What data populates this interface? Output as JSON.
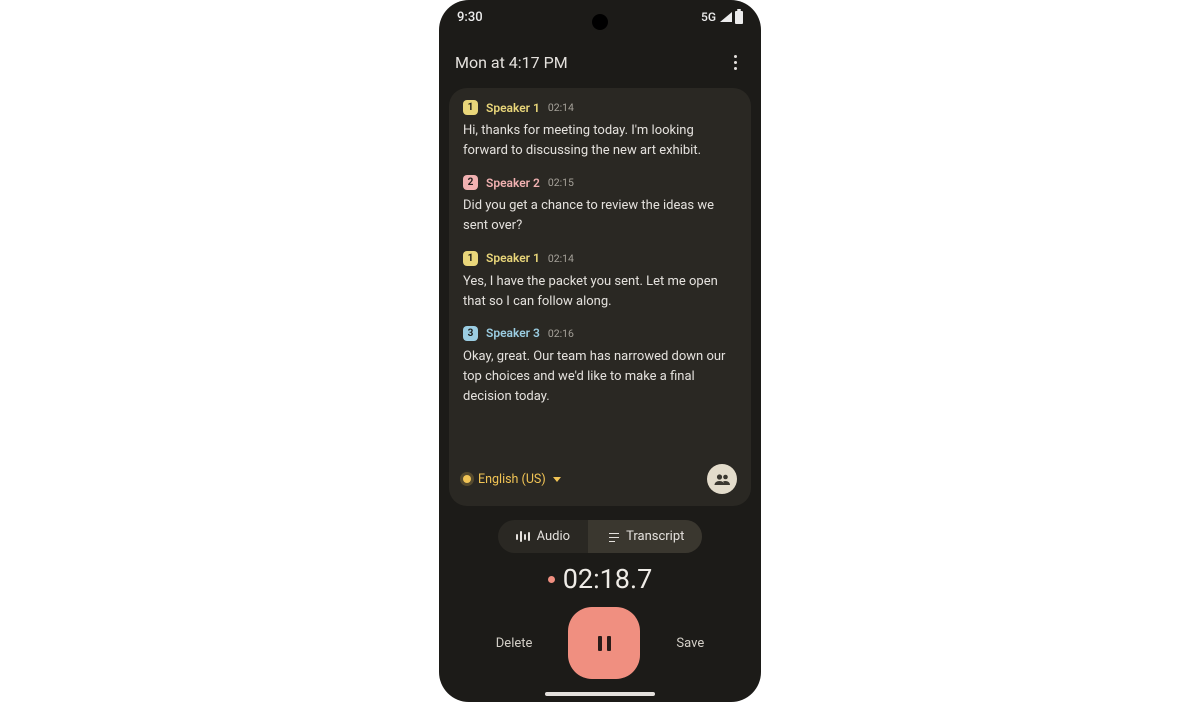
{
  "status": {
    "clock": "9:30",
    "network": "5G"
  },
  "toolbar": {
    "title": "Mon at 4:17 PM"
  },
  "speaker_styles": {
    "1": {
      "badge_bg": "#e9d67a",
      "name_color": "#e9d67a"
    },
    "2": {
      "badge_bg": "#f1b1b1",
      "name_color": "#f1b1b1"
    },
    "3": {
      "badge_bg": "#9bcde2",
      "name_color": "#9bcde2"
    }
  },
  "transcript": [
    {
      "speaker_id": "1",
      "speaker": "Speaker 1",
      "time": "02:14",
      "text": "Hi, thanks for meeting today. I'm looking forward to discussing the new art exhibit."
    },
    {
      "speaker_id": "2",
      "speaker": "Speaker 2",
      "time": "02:15",
      "text": "Did you get a chance to review the ideas we sent over?"
    },
    {
      "speaker_id": "1",
      "speaker": "Speaker 1",
      "time": "02:14",
      "text": "Yes, I have the packet you sent. Let me open that so I can follow along."
    },
    {
      "speaker_id": "3",
      "speaker": "Speaker 3",
      "time": "02:16",
      "text": "Okay, great. Our team has narrowed down our top choices and we'd like to make a final decision today."
    }
  ],
  "language": "English (US)",
  "tabs": {
    "audio": "Audio",
    "transcript": "Transcript"
  },
  "timer": "02:18.7",
  "buttons": {
    "delete": "Delete",
    "save": "Save"
  }
}
